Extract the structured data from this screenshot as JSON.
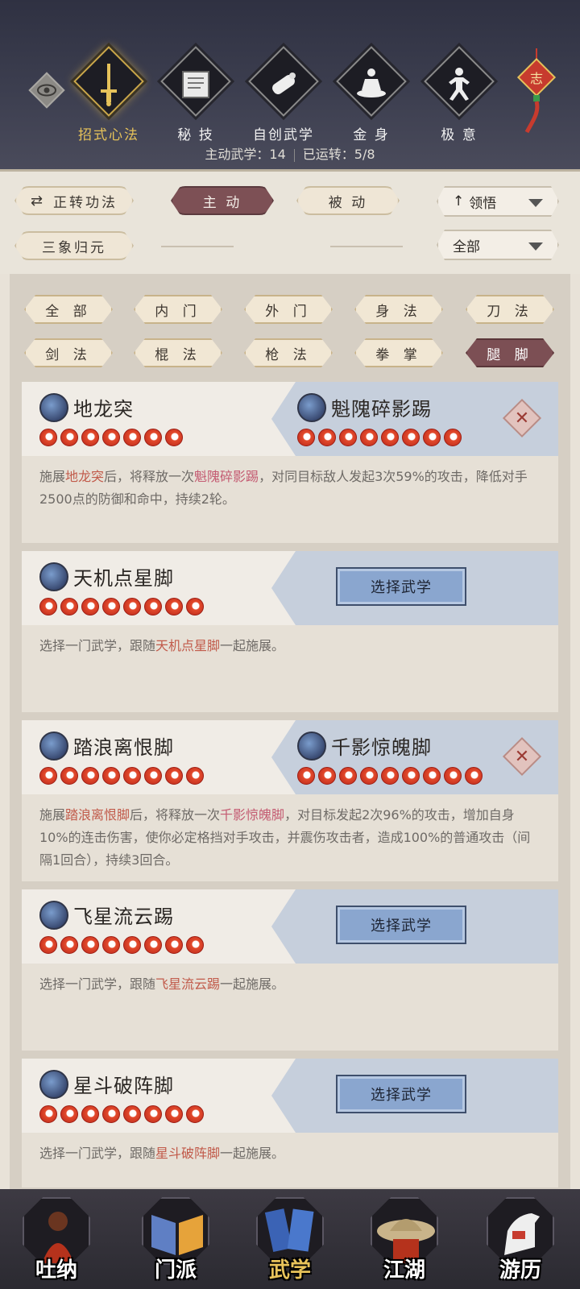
{
  "top_nav": {
    "items": [
      {
        "label": "招式心法",
        "icon": "sword-icon",
        "active": true
      },
      {
        "label": "秘 技",
        "icon": "book-icon",
        "active": false
      },
      {
        "label": "自创武学",
        "icon": "scroll-icon",
        "active": false
      },
      {
        "label": "金 身",
        "icon": "meditation-icon",
        "active": false
      },
      {
        "label": "极 意",
        "icon": "martial-stance-icon",
        "active": false
      }
    ],
    "knot_char": "志",
    "stats": {
      "active_label": "主动武学：14",
      "used_label": "已运转：5/8"
    }
  },
  "controls": {
    "forward_label": "正转功法",
    "active_tab": "主 动",
    "passive_tab": "被 动",
    "sanxiang_label": "三象归元",
    "sort_select": "领悟",
    "filter_select": "全部"
  },
  "filters": [
    {
      "label": "全 部",
      "active": false
    },
    {
      "label": "内 门",
      "active": false
    },
    {
      "label": "外 门",
      "active": false
    },
    {
      "label": "身 法",
      "active": false
    },
    {
      "label": "刀 法",
      "active": false
    },
    {
      "label": "剑 法",
      "active": false
    },
    {
      "label": "棍 法",
      "active": false
    },
    {
      "label": "枪 法",
      "active": false
    },
    {
      "label": "拳 掌",
      "active": false
    },
    {
      "label": "腿 脚",
      "active": true
    }
  ],
  "cards": [
    {
      "left_name": "地龙突",
      "left_dots": 7,
      "right_name": "魁隗碎影踢",
      "right_dots": 8,
      "desc_parts": [
        "施展",
        "地龙突",
        "后，将释放一次",
        "魁隗碎影踢",
        "，对同目标敌人发起3次59%的攻击，降低对手2500点的防御和命中，持续2轮。"
      ]
    },
    {
      "left_name": "天机点星脚",
      "left_dots": 8,
      "button": "选择武学",
      "desc_parts": [
        "选择一门武学，跟随",
        "天机点星脚",
        "一起施展。"
      ]
    },
    {
      "left_name": "踏浪离恨脚",
      "left_dots": 8,
      "right_name": "千影惊魄脚",
      "right_dots": 9,
      "desc_parts": [
        "施展",
        "踏浪离恨脚",
        "后，将释放一次",
        "千影惊魄脚",
        "，对目标发起2次96%的攻击，增加自身10%的连击伤害，使你必定格挡对手攻击，并震伤攻击者，造成100%的普通攻击（间隔1回合），持续3回合。"
      ]
    },
    {
      "left_name": "飞星流云踢",
      "left_dots": 8,
      "button": "选择武学",
      "desc_parts": [
        "选择一门武学，跟随",
        "飞星流云踢",
        "一起施展。"
      ]
    },
    {
      "left_name": "星斗破阵脚",
      "left_dots": 8,
      "button": "选择武学",
      "desc_parts": [
        "选择一门武学，跟随",
        "星斗破阵脚",
        "一起施展。"
      ]
    }
  ],
  "bottom_nav": [
    {
      "label": "吐纳",
      "active": false
    },
    {
      "label": "门派",
      "active": false
    },
    {
      "label": "武学",
      "active": true
    },
    {
      "label": "江湖",
      "active": false
    },
    {
      "label": "游历",
      "active": false
    }
  ]
}
